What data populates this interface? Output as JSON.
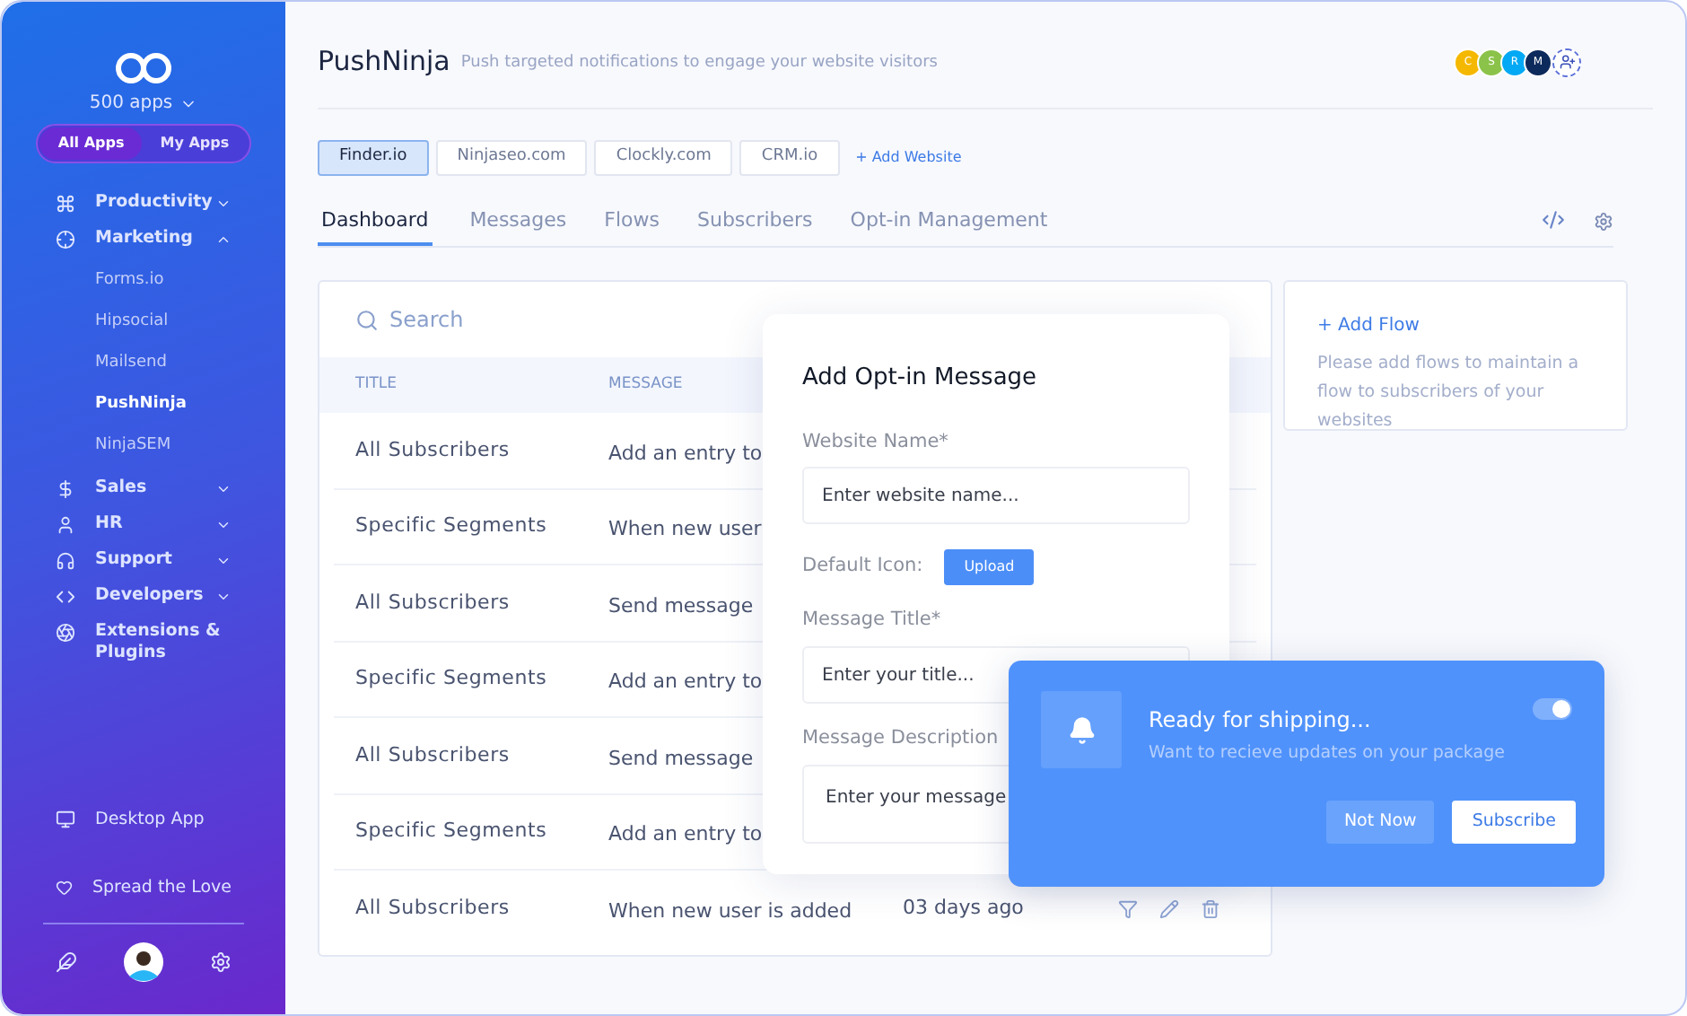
{
  "sidebar": {
    "apps_count": "500 apps",
    "app_filter": [
      {
        "label": "All Apps",
        "selected": true
      },
      {
        "label": "My Apps",
        "selected": false
      }
    ],
    "items": [
      {
        "label": "Productivity",
        "expanded": false
      },
      {
        "label": "Marketing",
        "expanded": true,
        "children": [
          {
            "label": "Forms.io",
            "selected": false
          },
          {
            "label": "Hipsocial",
            "selected": false
          },
          {
            "label": "Mailsend",
            "selected": false
          },
          {
            "label": "PushNinja",
            "selected": true
          },
          {
            "label": "NinjaSEM",
            "selected": false
          }
        ]
      },
      {
        "label": "Sales",
        "expanded": false
      },
      {
        "label": "HR",
        "expanded": false
      },
      {
        "label": "Support",
        "expanded": false
      },
      {
        "label": "Developers",
        "expanded": false
      },
      {
        "label": "Extensions & Plugins"
      }
    ],
    "bottom_items": [
      "Desktop App",
      "Spread the Love"
    ]
  },
  "header": {
    "title": "PushNinja",
    "subtitle": "Push targeted notifications to engage your website visitors",
    "team": [
      {
        "initial": "C",
        "color": "#f5b800"
      },
      {
        "initial": "S",
        "color": "#8bc34a"
      },
      {
        "initial": "R",
        "color": "#03a9f4"
      },
      {
        "initial": "M",
        "color": "#0d2a5c"
      }
    ]
  },
  "websites": [
    {
      "label": "Finder.io",
      "selected": true
    },
    {
      "label": "Ninjaseo.com",
      "selected": false
    },
    {
      "label": "Clockly.com",
      "selected": false
    },
    {
      "label": "CRM.io",
      "selected": false
    }
  ],
  "add_website": "+ Add Website",
  "tabs": [
    {
      "label": "Dashboard",
      "selected": true
    },
    {
      "label": "Messages",
      "selected": false
    },
    {
      "label": "Flows",
      "selected": false
    },
    {
      "label": "Subscribers",
      "selected": false
    },
    {
      "label": "Opt-in Management",
      "selected": false
    }
  ],
  "search": {
    "placeholder": "Search"
  },
  "table": {
    "columns": [
      "TITLE",
      "MESSAGE"
    ],
    "rows": [
      {
        "title": "All Subscribers",
        "message": "Add an entry to"
      },
      {
        "title": "Specific Segments",
        "message": "When new user"
      },
      {
        "title": "All Subscribers",
        "message": "Send message"
      },
      {
        "title": "Specific Segments",
        "message": "Add an entry to"
      },
      {
        "title": "All Subscribers",
        "message": "Send message"
      },
      {
        "title": "Specific Segments",
        "message": "Add an entry to"
      },
      {
        "title": "All Subscribers",
        "message": "When new user is added",
        "time": "03 days ago"
      }
    ]
  },
  "flows_card": {
    "link": "+ Add Flow",
    "text": "Please add flows to maintain a flow to subscribers of your websites"
  },
  "modal": {
    "title": "Add Opt-in Message",
    "fields": [
      {
        "label": "Website Name*",
        "placeholder": "Enter website name..."
      },
      {
        "label": "Message Title*",
        "placeholder": "Enter your title..."
      },
      {
        "label": "Message Description",
        "placeholder": "Enter your message"
      }
    ],
    "icon_label": "Default Icon:",
    "upload": "Upload"
  },
  "toast": {
    "title": "Ready for shipping...",
    "text": "Want to recieve updates on your package",
    "on": true,
    "buttons": [
      "Not Now",
      "Subscribe"
    ]
  }
}
